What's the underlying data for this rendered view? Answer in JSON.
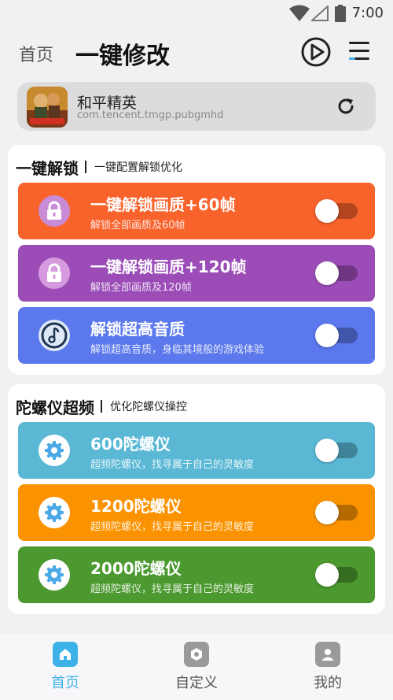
{
  "status": {
    "time": "7:00"
  },
  "header": {
    "home_label": "首页",
    "title": "一键修改"
  },
  "app": {
    "name": "和平精英",
    "package": "com.tencent.tmgp.pubgmhd"
  },
  "sections": [
    {
      "title": "一键解锁",
      "subtitle": "一键配置解锁优化",
      "items": [
        {
          "title": "一键解锁画质+60帧",
          "desc": "解锁全部画质及60帧",
          "color": "#f8622b",
          "icon": "lock-icon",
          "enabled": false
        },
        {
          "title": "一键解锁画质+120帧",
          "desc": "解锁全部画质及120帧",
          "color": "#9b4cb7",
          "icon": "lock-icon",
          "enabled": false
        },
        {
          "title": "解锁超高音质",
          "desc": "解锁超高音质，身临其境般的游戏体验",
          "color": "#5b78ec",
          "icon": "music-note-icon",
          "enabled": false
        }
      ]
    },
    {
      "title": "陀螺仪超频",
      "subtitle": "优化陀螺仪操控",
      "items": [
        {
          "title": "600陀螺仪",
          "desc": "超频陀螺仪，找寻属于自己的灵敏度",
          "color": "#5ab8d5",
          "icon": "gear-icon",
          "enabled": false
        },
        {
          "title": "1200陀螺仪",
          "desc": "超频陀螺仪，找寻属于自己的灵敏度",
          "color": "#fb9300",
          "icon": "gear-icon",
          "enabled": false
        },
        {
          "title": "2000陀螺仪",
          "desc": "超频陀螺仪，找寻属于自己的灵敏度",
          "color": "#4c992f",
          "icon": "gear-icon",
          "enabled": false
        }
      ]
    }
  ],
  "nav": [
    {
      "label": "首页",
      "icon": "home-icon",
      "active": true
    },
    {
      "label": "自定义",
      "icon": "custom-icon",
      "active": false
    },
    {
      "label": "我的",
      "icon": "profile-icon",
      "active": false
    }
  ],
  "colors": {
    "accent": "#3cb2e8",
    "background": "#f1f1f4"
  }
}
